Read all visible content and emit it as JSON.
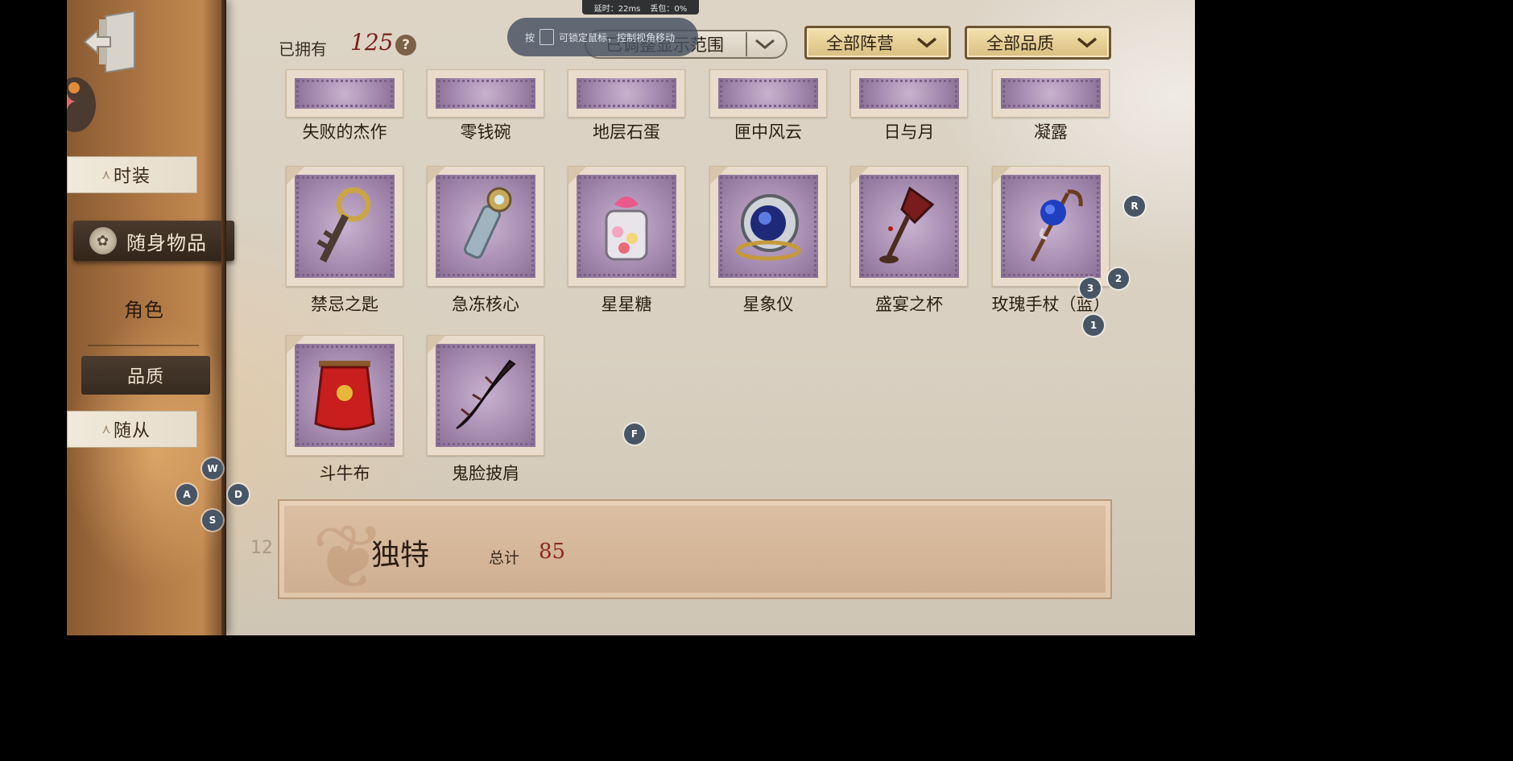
{
  "header": {
    "owned_label": "已拥有",
    "owned_count": "125",
    "help_symbol": "?",
    "filter_scope": "已调整显示范围",
    "filter_faction": "全部阵营",
    "filter_quality": "全部品质"
  },
  "overlay": {
    "latency": "延时：22ms",
    "packet_loss": "丢包：0%",
    "hint_prefix": "按",
    "hint_text": "可锁定鼠标，控制视角移动"
  },
  "sidebar": {
    "tab_costume": "时装",
    "tab_accessory": "随身物品",
    "label_character": "角色",
    "btn_quality": "品质",
    "tab_companion": "随从"
  },
  "items_top_row": [
    {
      "name": "失败的杰作"
    },
    {
      "name": "零钱碗"
    },
    {
      "name": "地层石蛋"
    },
    {
      "name": "匣中风云"
    },
    {
      "name": "日与月"
    },
    {
      "name": "凝露"
    }
  ],
  "items": [
    {
      "name": "禁忌之匙",
      "icon": "key-icon"
    },
    {
      "name": "急冻核心",
      "icon": "frost-core-icon"
    },
    {
      "name": "星星糖",
      "icon": "candy-jar-icon"
    },
    {
      "name": "星象仪",
      "icon": "astrolabe-icon"
    },
    {
      "name": "盛宴之杯",
      "icon": "goblet-icon"
    },
    {
      "name": "玫瑰手杖（蓝）",
      "icon": "rose-cane-icon"
    },
    {
      "name": "斗牛布",
      "icon": "matador-cape-icon"
    },
    {
      "name": "鬼脸披肩",
      "icon": "shawl-icon"
    }
  ],
  "footer": {
    "title": "独特",
    "total_label": "总计",
    "total_value": "85",
    "side_number": "12"
  },
  "keys": {
    "r": "R",
    "one": "1",
    "two": "2",
    "three": "3",
    "f": "F",
    "w": "W",
    "a": "A",
    "s": "S",
    "d": "D"
  }
}
